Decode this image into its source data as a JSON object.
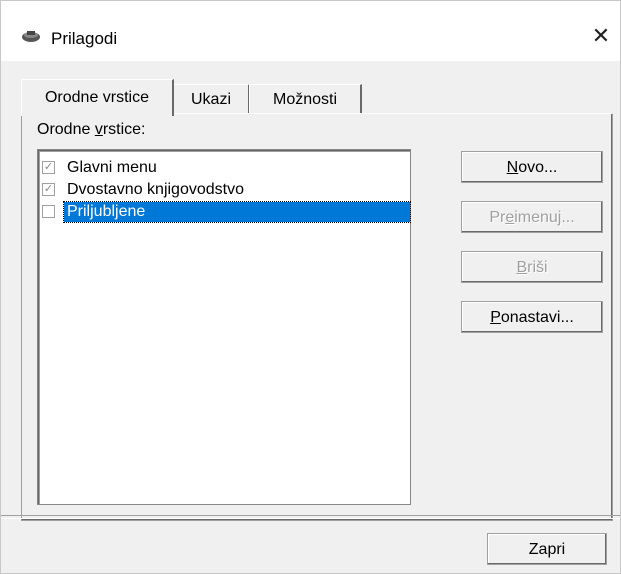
{
  "window": {
    "title": "Prilagodi",
    "close_glyph": "✕"
  },
  "tabs": [
    {
      "label": "Orodne vrstice",
      "active": true
    },
    {
      "label": "Ukazi",
      "active": false
    },
    {
      "label": "Možnosti",
      "active": false
    }
  ],
  "list": {
    "label_before": "Orodne ",
    "label_underlined": "v",
    "label_after": "rstice:",
    "items": [
      {
        "label": "Glavni menu",
        "checked": true,
        "selected": false
      },
      {
        "label": "Dvostavno knjigovodstvo",
        "checked": true,
        "selected": false
      },
      {
        "label": "Priljubljene",
        "checked": false,
        "selected": true
      }
    ]
  },
  "buttons": {
    "new": {
      "underlined": "N",
      "rest": "ovo...",
      "enabled": true
    },
    "rename": {
      "pre": "Pr",
      "underlined": "e",
      "rest": "imenuj...",
      "enabled": false
    },
    "delete": {
      "underlined": "B",
      "rest": "riši",
      "enabled": false
    },
    "reset": {
      "underlined": "P",
      "rest": "onastavi...",
      "enabled": true
    },
    "close": {
      "label": "Zapri",
      "enabled": true
    }
  }
}
